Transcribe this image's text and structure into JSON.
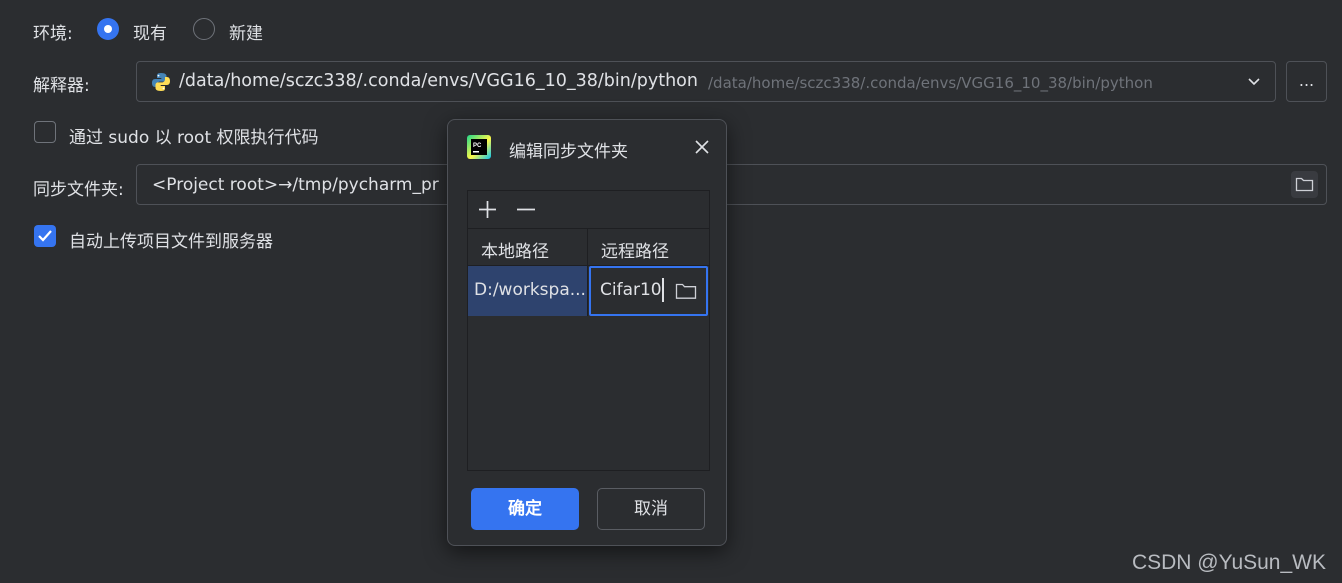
{
  "form": {
    "env_label": "环境:",
    "env_options": [
      {
        "label": "现有",
        "selected": true
      },
      {
        "label": "新建",
        "selected": false
      }
    ],
    "interpreter_label": "解释器:",
    "interpreter_path": "/data/home/sczc338/.conda/envs/VGG16_10_38/bin/python",
    "interpreter_hint": "/data/home/sczc338/.conda/envs/VGG16_10_38/bin/python",
    "more_button": "...",
    "sudo_label": "通过 sudo 以 root 权限执行代码",
    "sudo_checked": false,
    "sync_label": "同步文件夹:",
    "sync_value": "<Project root>→/tmp/pycharm_pr",
    "auto_upload_label": "自动上传项目文件到服务器",
    "auto_upload_checked": true
  },
  "dialog": {
    "title": "编辑同步文件夹",
    "add_icon": "plus-icon",
    "remove_icon": "minus-icon",
    "columns": [
      "本地路径",
      "远程路径"
    ],
    "rows": [
      {
        "local": "D:/workspa...",
        "remote": "Cifar10"
      }
    ],
    "ok_label": "确定",
    "cancel_label": "取消"
  },
  "watermark": "CSDN @YuSun_WK",
  "colors": {
    "background": "#2b2d30",
    "accent": "#3574f0",
    "selected_row": "#2e436e",
    "border": "#4e5157"
  }
}
